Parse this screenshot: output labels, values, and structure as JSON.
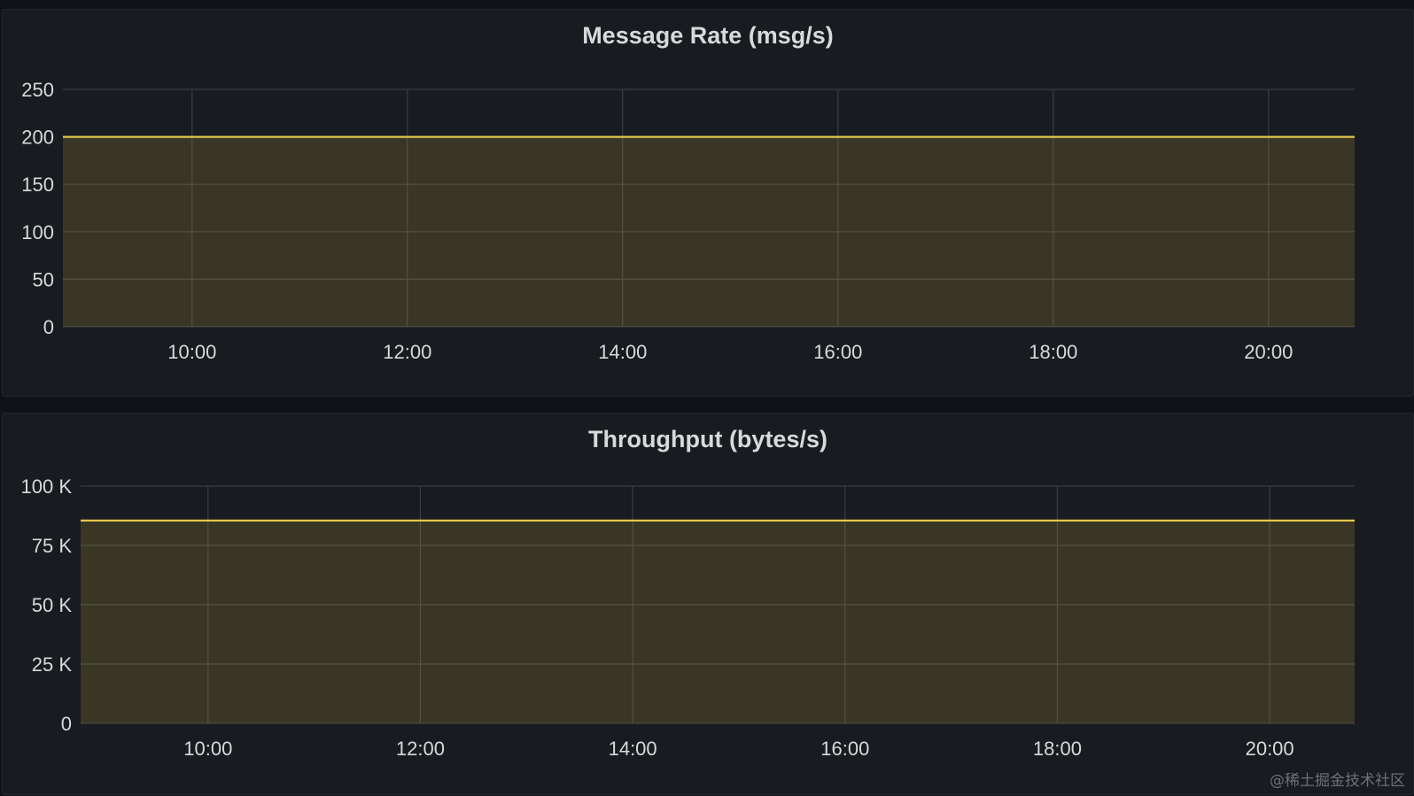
{
  "chart_data": [
    {
      "type": "area",
      "title": "Message Rate (msg/s)",
      "xlabel": "",
      "ylabel": "",
      "x_ticks": [
        "10:00",
        "12:00",
        "14:00",
        "16:00",
        "18:00",
        "20:00"
      ],
      "y_ticks": [
        "0",
        "50",
        "100",
        "150",
        "200",
        "250"
      ],
      "xlim": [
        "08:48",
        "20:48"
      ],
      "ylim": [
        0,
        250
      ],
      "grid": true,
      "color": "#e6c84c",
      "series": [
        {
          "x": [
            "08:48",
            "10:00",
            "12:00",
            "14:00",
            "16:00",
            "18:00",
            "20:00",
            "20:48"
          ],
          "values": [
            200,
            200,
            200,
            200,
            200,
            200,
            200,
            200
          ]
        }
      ]
    },
    {
      "type": "area",
      "title": "Throughput (bytes/s)",
      "xlabel": "",
      "ylabel": "",
      "x_ticks": [
        "10:00",
        "12:00",
        "14:00",
        "16:00",
        "18:00",
        "20:00"
      ],
      "y_ticks": [
        "0",
        "25 K",
        "50 K",
        "75 K",
        "100 K"
      ],
      "xlim": [
        "08:48",
        "20:48"
      ],
      "ylim": [
        0,
        100000
      ],
      "grid": true,
      "color": "#e6c84c",
      "series": [
        {
          "x": [
            "08:48",
            "10:00",
            "12:00",
            "14:00",
            "16:00",
            "18:00",
            "20:00",
            "20:48"
          ],
          "values": [
            85500,
            85500,
            85500,
            85500,
            85500,
            85500,
            85500,
            85500
          ]
        }
      ]
    }
  ],
  "watermark": "@稀土掘金技术社区"
}
